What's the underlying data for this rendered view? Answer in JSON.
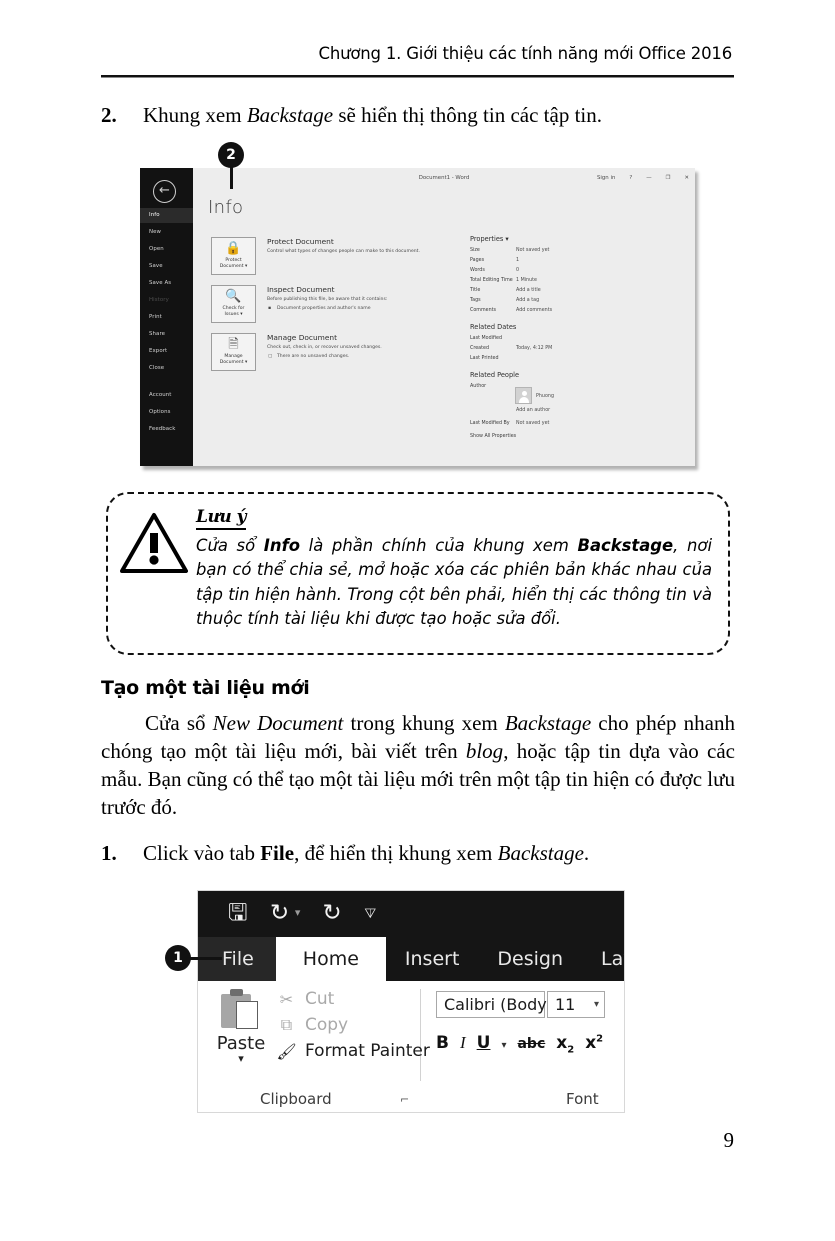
{
  "header": {
    "text": "Chương 1. Giới thiệu các tính năng mới Office 2016"
  },
  "step2": {
    "number": "2.",
    "text_1": "Khung xem ",
    "italic_1": "Backstage",
    "text_2": " sẽ hiển thị thông tin các tập tin."
  },
  "callouts": {
    "two": "2",
    "one": "1"
  },
  "backstage": {
    "titlebar": {
      "document_title": "Document1 - Word",
      "sign_in": "Sign in",
      "help_icon": "?",
      "minimize_icon": "—",
      "maximize_icon": "❐",
      "close_icon": "✕"
    },
    "back_arrow": "←",
    "heading": "Info",
    "rail": [
      {
        "label": "Info",
        "state": "selected"
      },
      {
        "label": "New",
        "state": "normal"
      },
      {
        "label": "Open",
        "state": "normal"
      },
      {
        "label": "Save",
        "state": "normal"
      },
      {
        "label": "Save As",
        "state": "normal"
      },
      {
        "label": "History",
        "state": "dim"
      },
      {
        "label": "Print",
        "state": "normal"
      },
      {
        "label": "Share",
        "state": "normal"
      },
      {
        "label": "Export",
        "state": "normal"
      },
      {
        "label": "Close",
        "state": "normal"
      },
      {
        "label": "Account",
        "state": "normal"
      },
      {
        "label": "Options",
        "state": "normal"
      },
      {
        "label": "Feedback",
        "state": "normal"
      }
    ],
    "blocks": [
      {
        "card_label": "Protect\nDocument ▾",
        "card_icon": "lock-icon",
        "title": "Protect Document",
        "desc": "Control what types of changes people can make to this document."
      },
      {
        "card_label": "Check for\nIssues ▾",
        "card_icon": "magnifier-document-icon",
        "title": "Inspect Document",
        "desc": "Before publishing this file, be aware that it contains:",
        "bullet": "Document properties and author's name"
      },
      {
        "card_label": "Manage\nDocument ▾",
        "card_icon": "document-stack-icon",
        "title": "Manage Document",
        "desc": "Check out, check in, or recover unsaved changes.",
        "bullet": "There are no unsaved changes."
      }
    ],
    "properties": {
      "heading": "Properties ▾",
      "rows": [
        {
          "label": "Size",
          "value": "Not saved yet"
        },
        {
          "label": "Pages",
          "value": "1"
        },
        {
          "label": "Words",
          "value": "0"
        },
        {
          "label": "Total Editing Time",
          "value": "1 Minute"
        },
        {
          "label": "Title",
          "value": "Add a title"
        },
        {
          "label": "Tags",
          "value": "Add a tag"
        },
        {
          "label": "Comments",
          "value": "Add comments"
        }
      ]
    },
    "related_dates": {
      "heading": "Related Dates",
      "rows": [
        {
          "label": "Last Modified",
          "value": ""
        },
        {
          "label": "Created",
          "value": "Today, 4:12 PM"
        },
        {
          "label": "Last Printed",
          "value": ""
        }
      ]
    },
    "related_people": {
      "heading": "Related People",
      "author_label": "Author",
      "author_name": "Phuong",
      "add_author": "Add an author",
      "last_modified_by_label": "Last Modified By",
      "last_modified_by_value": "Not saved yet",
      "show_all": "Show All Properties"
    }
  },
  "note": {
    "title": "Lưu ý",
    "segments": [
      {
        "t": "Cửa sổ ",
        "b": false
      },
      {
        "t": "Info",
        "b": true
      },
      {
        "t": " là phần chính của khung xem ",
        "b": false
      },
      {
        "t": "Backstage",
        "b": true
      },
      {
        "t": ", nơi bạn có thể chia sẻ, mở hoặc xóa các phiên bản khác nhau của tập tin hiện hành. Trong cột bên phải, hiển thị các thông tin và thuộc tính tài liệu khi được tạo hoặc sửa đổi.",
        "b": false
      }
    ]
  },
  "section": {
    "title": "Tạo một tài liệu mới",
    "paragraph_1": "Cửa sổ ",
    "paragraph_italic_1": "New Document",
    "paragraph_2": " trong khung xem ",
    "paragraph_italic_2": "Backstage",
    "paragraph_3": " cho phép nhanh chóng tạo một tài liệu mới, bài viết trên ",
    "paragraph_italic_3": "blog",
    "paragraph_4": ", hoặc tập tin dựa vào các mẫu. Bạn cũng có thể tạo một tài liệu mới trên một tập tin hiện có được lưu trước đó."
  },
  "step1": {
    "number": "1.",
    "text_1": "Click vào tab ",
    "bold_1": "File",
    "text_2": ", để hiển thị khung xem ",
    "italic_1": "Backstage",
    "text_3": "."
  },
  "ribbon": {
    "quick_access": [
      {
        "name": "save-icon",
        "glyph": "🖫"
      },
      {
        "name": "undo-icon",
        "glyph": "↺"
      },
      {
        "name": "undo-dropdown-icon",
        "glyph": "▾"
      },
      {
        "name": "redo-icon",
        "glyph": "↻"
      },
      {
        "name": "customize-qat-icon",
        "glyph": "⩥"
      }
    ],
    "tabs": [
      {
        "label": "File",
        "state": "file"
      },
      {
        "label": "Home",
        "state": "active"
      },
      {
        "label": "Insert",
        "state": "normal"
      },
      {
        "label": "Design",
        "state": "normal"
      },
      {
        "label": "Layout",
        "state": "normal"
      }
    ],
    "clipboard": {
      "paste_label": "Paste",
      "paste_caret": "▾",
      "cut_label": "Cut",
      "copy_label": "Copy",
      "format_painter_label": "Format Painter",
      "group_label": "Clipboard",
      "launcher_icon": "⌐"
    },
    "font": {
      "font_name": "Calibri (Body)",
      "font_size": "11",
      "caret": "▾",
      "bold": "B",
      "italic": "I",
      "underline": "U",
      "underline_caret": "▾",
      "strikethrough": "abc",
      "subscript": "x",
      "subscript_sub": "2",
      "superscript": "x",
      "superscript_sup": "2",
      "group_label": "Font"
    }
  },
  "page_number": "9"
}
